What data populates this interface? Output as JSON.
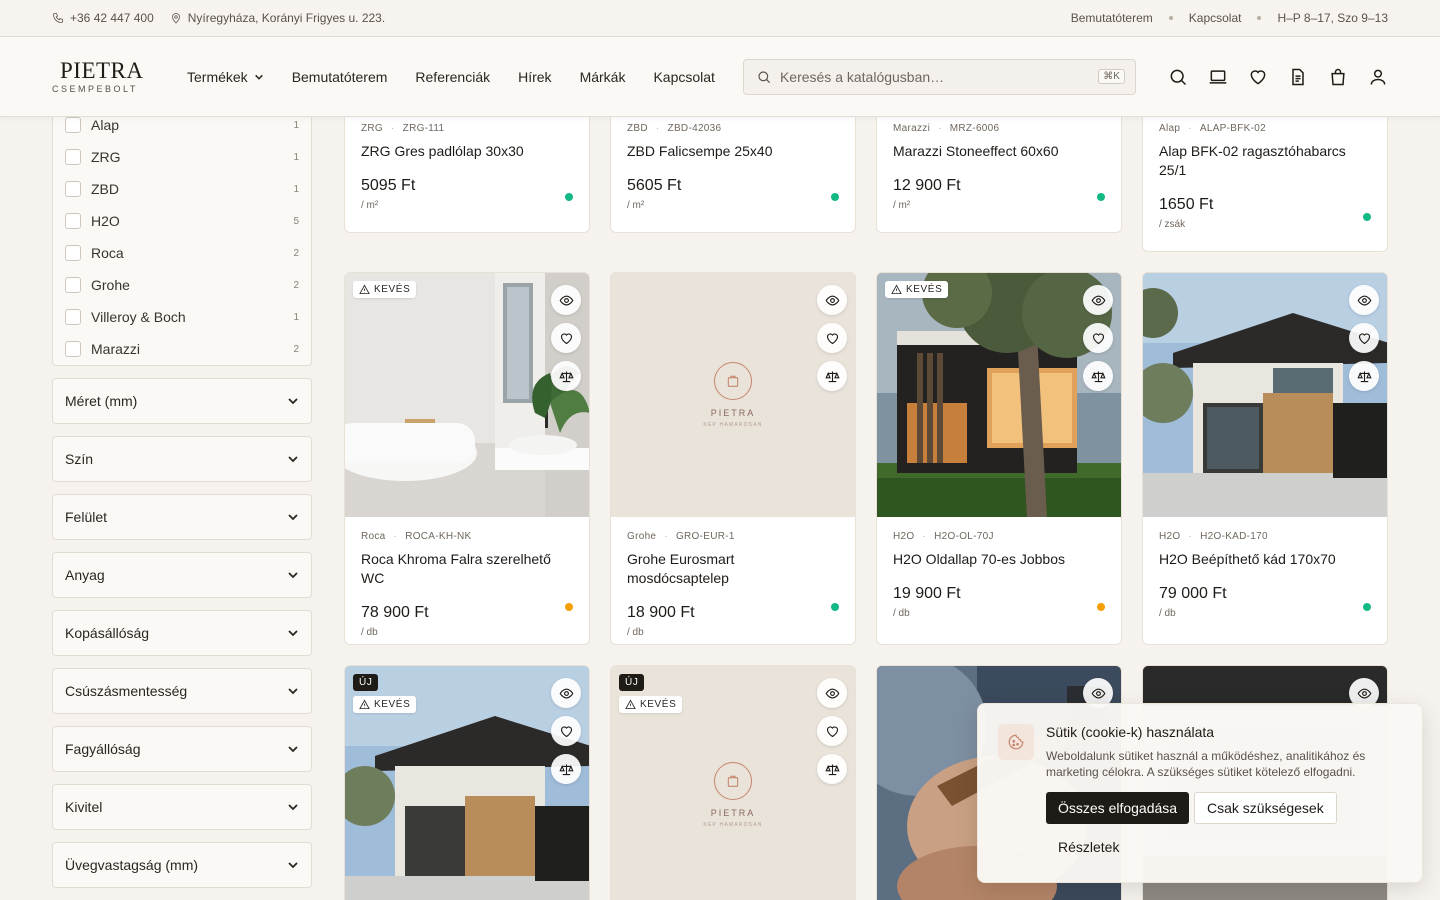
{
  "topbar": {
    "phone": "+36 42 447 400",
    "address": "Nyíregyháza, Korányi Frigyes u. 223.",
    "links": [
      "Bemutatóterem",
      "Kapcsolat"
    ],
    "hours": "H–P 8–17, Szo 9–13"
  },
  "header": {
    "logo_name": "PIETRA",
    "logo_sub": "CSEMPEBOLT",
    "nav": [
      "Termékek",
      "Bemutatóterem",
      "Referenciák",
      "Hírek",
      "Márkák",
      "Kapcsolat"
    ],
    "search_placeholder": "Keresés a katalógusban…",
    "search_shortcut": "⌘K",
    "icons": [
      "search-icon",
      "showroom-icon",
      "heart-icon",
      "document-icon",
      "cart-icon",
      "user-icon"
    ]
  },
  "sidebar": {
    "brands": [
      {
        "label": "Alap",
        "count": "1"
      },
      {
        "label": "ZRG",
        "count": "1"
      },
      {
        "label": "ZBD",
        "count": "1"
      },
      {
        "label": "H2O",
        "count": "5"
      },
      {
        "label": "Roca",
        "count": "2"
      },
      {
        "label": "Grohe",
        "count": "2"
      },
      {
        "label": "Villeroy & Boch",
        "count": "1"
      },
      {
        "label": "Marazzi",
        "count": "2"
      }
    ],
    "filters": [
      "Méret (mm)",
      "Szín",
      "Felület",
      "Anyag",
      "Kopásállóság",
      "Csúszásmentesség",
      "Fagyállóság",
      "Kivitel",
      "Üvegvastagság (mm)"
    ]
  },
  "products_row1": [
    {
      "brand": "ZRG",
      "sku": "ZRG-111",
      "title": "ZRG Gres padlólap 30x30",
      "price": "5095 Ft",
      "unit": "/ m²",
      "stock": "green"
    },
    {
      "brand": "ZBD",
      "sku": "ZBD-42036",
      "title": "ZBD Falicsempe 25x40",
      "price": "5605 Ft",
      "unit": "/ m²",
      "stock": "green"
    },
    {
      "brand": "Marazzi",
      "sku": "MRZ-6006",
      "title": "Marazzi Stoneeffect 60x60",
      "price": "12 900 Ft",
      "unit": "/ m²",
      "stock": "green"
    },
    {
      "brand": "Alap",
      "sku": "ALAP-BFK-02",
      "title": "Alap BFK-02 ragasztóhabarcs 25/1",
      "price": "1650 Ft",
      "unit": "/ zsák",
      "stock": "green"
    }
  ],
  "products_row2": [
    {
      "brand": "Roca",
      "sku": "ROCA-KH-NK",
      "title": "Roca Khroma Falra szerelhető WC",
      "price": "78 900 Ft",
      "unit": "/ db",
      "stock": "orange",
      "badge_low": "KEVÉS"
    },
    {
      "brand": "Grohe",
      "sku": "GRO-EUR-1",
      "title": "Grohe Eurosmart mosdócsaptelep",
      "price": "18 900 Ft",
      "unit": "/ db",
      "stock": "green"
    },
    {
      "brand": "H2O",
      "sku": "H2O-OL-70J",
      "title": "H2O Oldallap 70-es Jobbos",
      "price": "19 900 Ft",
      "unit": "/ db",
      "stock": "orange",
      "badge_low": "KEVÉS"
    },
    {
      "brand": "H2O",
      "sku": "H2O-KAD-170",
      "title": "H2O Beépíthető kád 170x70",
      "price": "79 000 Ft",
      "unit": "/ db",
      "stock": "green"
    }
  ],
  "row3_badges": {
    "new": "ÚJ",
    "low": "KEVÉS"
  },
  "placeholder": {
    "brand": "PIETRA",
    "caption": "KÉP HAMAROSAN"
  },
  "cookie": {
    "title": "Sütik (cookie-k) használata",
    "text": "Weboldalunk sütiket használ a működéshez, analitikához és marketing célokra. A szükséges sütiket kötelező elfogadni.",
    "accept_all": "Összes elfogadása",
    "necessary_only": "Csak szükségesek",
    "details": "Részletek"
  },
  "colors": {
    "accent": "#c7866f",
    "stock_green": "#12b886",
    "stock_orange": "#f59f00",
    "dark": "#1f1b17"
  }
}
